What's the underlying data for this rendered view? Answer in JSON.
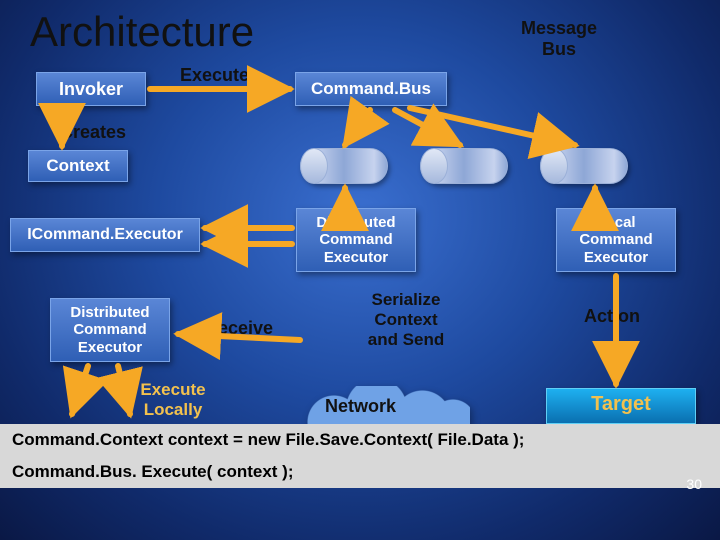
{
  "title": "Architecture",
  "msgbus": "Message\nBus",
  "boxes": {
    "invoker": "Invoker",
    "command_bus": "Command.Bus",
    "context": "Context",
    "icommand_executor": "ICommand.Executor",
    "distributed_cmd_exec": "Distributed\nCommand\nExecutor",
    "local_cmd_exec": "Local\nCommand\nExecutor",
    "distributed_cmd_exec2": "Distributed\nCommand\nExecutor"
  },
  "labels": {
    "execute": "Execute",
    "creates": "Creates",
    "receive": "Receive",
    "serialize": "Serialize\nContext\nand Send",
    "action": "Action",
    "execute_locally": "Execute\nLocally",
    "network": "Network",
    "target": "Target"
  },
  "code": {
    "line1": "Command.Context context = new File.Save.Context( File.Data );",
    "line2": "Command.Bus. Execute( context );"
  },
  "page": "30"
}
